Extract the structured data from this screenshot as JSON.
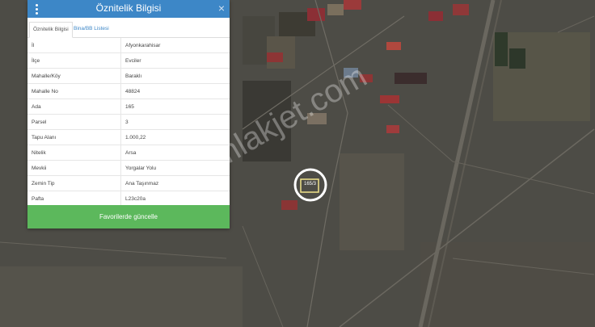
{
  "panel": {
    "title": "Öznitelik Bilgisi",
    "menu_icon": "vertical-dots-icon",
    "close_icon": "close-icon",
    "close_glyph": "×",
    "tabs": [
      {
        "label": "Öznitelik Bilgisi",
        "active": true
      },
      {
        "label": "Bina/BB Listesi",
        "active": false
      }
    ],
    "rows": [
      {
        "label": "İl",
        "value": "Afyonkarahisar"
      },
      {
        "label": "İlçe",
        "value": "Evciler"
      },
      {
        "label": "Mahalle/Köy",
        "value": "Baraklı"
      },
      {
        "label": "Mahalle No",
        "value": "48824"
      },
      {
        "label": "Ada",
        "value": "165"
      },
      {
        "label": "Parsel",
        "value": "3"
      },
      {
        "label": "Tapu Alanı",
        "value": "1.000,22"
      },
      {
        "label": "Nitelik",
        "value": "Arsa"
      },
      {
        "label": "Mevkii",
        "value": "Yorgalar Yolu"
      },
      {
        "label": "Zemin Tip",
        "value": "Ana Taşınmaz"
      },
      {
        "label": "Pafta",
        "value": "L23c20a"
      }
    ],
    "button_label": "Favorilerde güncelle"
  },
  "map": {
    "watermark": "emlakjet.com",
    "parcel_label": "165/3"
  },
  "colors": {
    "header": "#3d87c7",
    "button": "#5cb85c",
    "highlight_ring": "#ffffff"
  }
}
